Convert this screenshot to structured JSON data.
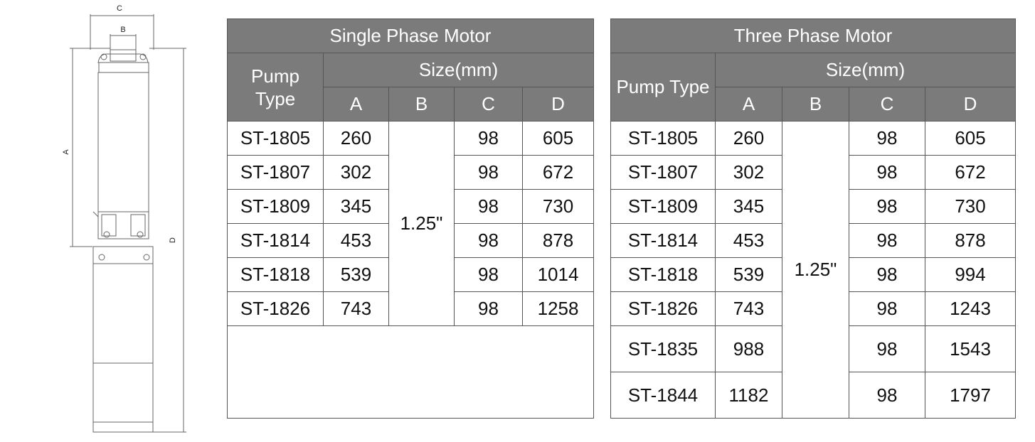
{
  "diagram": {
    "labels": {
      "a": "A",
      "b": "B",
      "c": "C",
      "d": "D"
    }
  },
  "single": {
    "title": "Single Phase Motor",
    "pump_type": "Pump Type",
    "size": "Size(mm)",
    "cols": [
      "A",
      "B",
      "C",
      "D"
    ],
    "b_value": "1.25\"",
    "rows": [
      {
        "type": "ST-1805",
        "a": "260",
        "c": "98",
        "d": "605"
      },
      {
        "type": "ST-1807",
        "a": "302",
        "c": "98",
        "d": "672"
      },
      {
        "type": "ST-1809",
        "a": "345",
        "c": "98",
        "d": "730"
      },
      {
        "type": "ST-1814",
        "a": "453",
        "c": "98",
        "d": "878"
      },
      {
        "type": "ST-1818",
        "a": "539",
        "c": "98",
        "d": "1014"
      },
      {
        "type": "ST-1826",
        "a": "743",
        "c": "98",
        "d": "1258"
      }
    ]
  },
  "three": {
    "title": "Three Phase Motor",
    "pump_type": "Pump Type",
    "size": "Size(mm)",
    "cols": [
      "A",
      "B",
      "C",
      "D"
    ],
    "b_value": "1.25\"",
    "rows": [
      {
        "type": "ST-1805",
        "a": "260",
        "c": "98",
        "d": "605"
      },
      {
        "type": "ST-1807",
        "a": "302",
        "c": "98",
        "d": "672"
      },
      {
        "type": "ST-1809",
        "a": "345",
        "c": "98",
        "d": "730"
      },
      {
        "type": "ST-1814",
        "a": "453",
        "c": "98",
        "d": "878"
      },
      {
        "type": "ST-1818",
        "a": "539",
        "c": "98",
        "d": "994"
      },
      {
        "type": "ST-1826",
        "a": "743",
        "c": "98",
        "d": "1243"
      },
      {
        "type": "ST-1835",
        "a": "988",
        "c": "98",
        "d": "1543"
      },
      {
        "type": "ST-1844",
        "a": "1182",
        "c": "98",
        "d": "1797"
      }
    ]
  }
}
